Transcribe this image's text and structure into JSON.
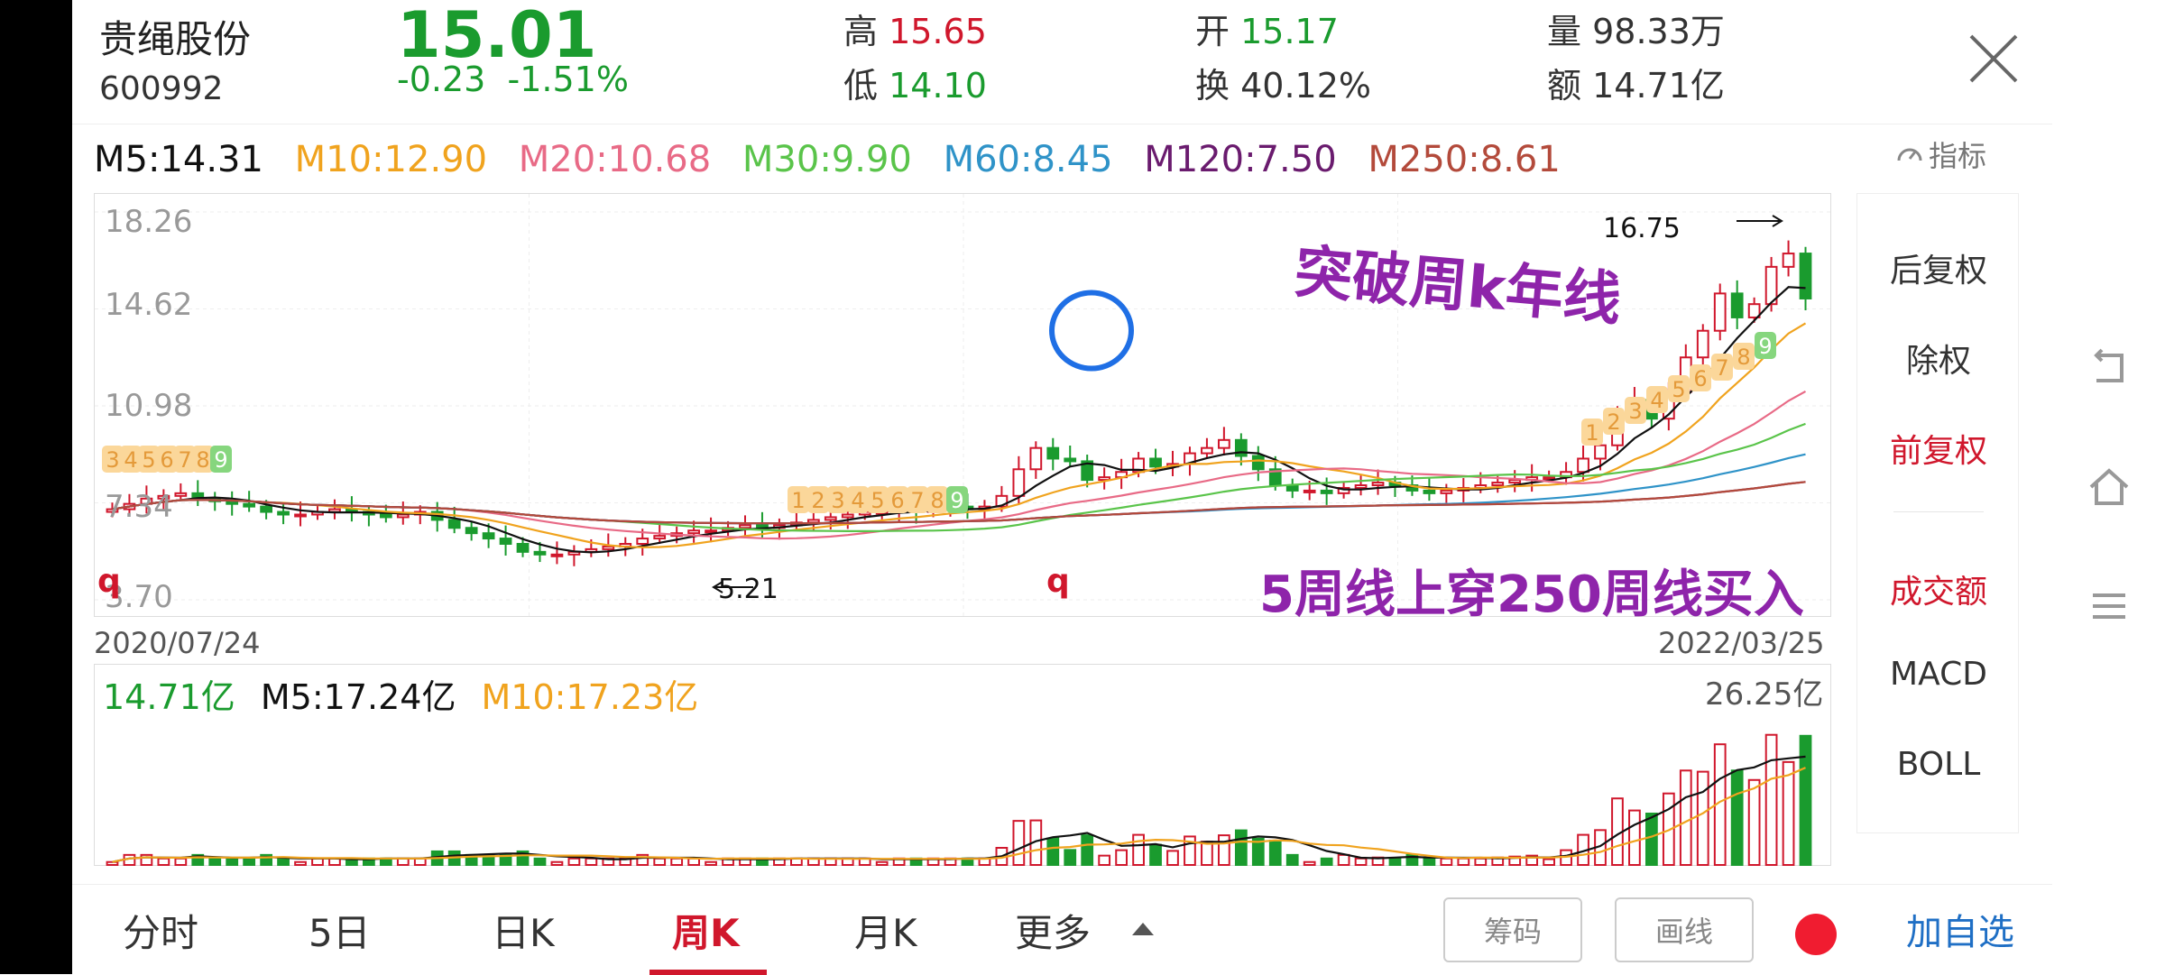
{
  "quote": {
    "name": "贵绳股份",
    "code": "600992",
    "price": "15.01",
    "change": "-0.23",
    "change_pct": "-1.51%",
    "high_label": "高",
    "high": "15.65",
    "low_label": "低",
    "low": "14.10",
    "open_label": "开",
    "open": "15.17",
    "turnover_label": "换",
    "turnover": "40.12%",
    "volume_label": "量",
    "volume": "98.33万",
    "amount_label": "额",
    "amount": "14.71亿"
  },
  "ma": {
    "m5": "M5:14.31",
    "m10": "M10:12.90",
    "m20": "M20:10.68",
    "m30": "M30:9.90",
    "m60": "M60:8.45",
    "m120": "M120:7.50",
    "m250": "M250:8.61"
  },
  "indicator_label": "指标",
  "axis": {
    "y_ticks": [
      "18.26",
      "14.62",
      "10.98",
      "7.34",
      "3.70"
    ],
    "start_date": "2020/07/24",
    "end_date": "2022/03/25"
  },
  "volume": {
    "value": "14.71亿",
    "m5": "M5:17.24亿",
    "m10": "M10:17.23亿",
    "max": "26.25亿"
  },
  "side_panel": {
    "items": [
      "后复权",
      "除权",
      "前复权",
      "成交额",
      "MACD",
      "BOLL"
    ],
    "active": "前复权"
  },
  "annotations": {
    "breakout": "突破周k年线",
    "buy_signal": "5周线上穿250周线买入",
    "high_mark": "16.75",
    "low_mark": "5.21",
    "q_left": "q",
    "q_mid": "q"
  },
  "td_counts": {
    "seq1": [
      "3",
      "4",
      "5",
      "6",
      "7",
      "8",
      "9"
    ],
    "seq2": [
      "1",
      "2",
      "3",
      "4",
      "5",
      "6",
      "7",
      "8",
      "9"
    ],
    "seq3": [
      "1",
      "2",
      "3",
      "4",
      "5",
      "6",
      "7",
      "8",
      "9"
    ]
  },
  "tabs": [
    "分时",
    "5日",
    "日K",
    "周K",
    "月K",
    "更多"
  ],
  "active_tab": "周K",
  "buttons": {
    "chips": "筹码",
    "draw": "画线",
    "add_fav": "加自选"
  },
  "colors": {
    "up": "#d0172c",
    "down": "#1a9b2e",
    "m5": "#111111",
    "m10": "#f0a31e",
    "m20": "#e86a86",
    "m30": "#5ac44a",
    "m60": "#2f93c8",
    "m120": "#6a1b6e",
    "m250": "#b34a3b",
    "annotation": "#8e24aa",
    "circle": "#1f6fe5"
  },
  "chart_data": {
    "type": "candlestick",
    "period": "weekly",
    "x_range": [
      "2020/07/24",
      "2022/03/25"
    ],
    "ylim": [
      3.7,
      18.26
    ],
    "close": [
      7.1,
      7.3,
      7.5,
      7.6,
      7.7,
      7.5,
      7.4,
      7.3,
      7.2,
      7.0,
      6.9,
      6.9,
      7.0,
      7.1,
      7.0,
      6.9,
      6.8,
      6.9,
      7.0,
      6.7,
      6.4,
      6.2,
      6.0,
      5.8,
      5.5,
      5.4,
      5.4,
      5.5,
      5.6,
      5.7,
      5.8,
      6.0,
      6.1,
      6.2,
      6.3,
      6.3,
      6.4,
      6.5,
      6.4,
      6.5,
      6.6,
      6.7,
      6.8,
      6.9,
      7.0,
      7.0,
      7.1,
      7.0,
      7.1,
      7.2,
      7.1,
      7.2,
      7.6,
      8.6,
      9.4,
      9.0,
      8.9,
      8.2,
      8.3,
      8.5,
      9.0,
      8.7,
      8.8,
      9.2,
      9.4,
      9.7,
      9.1,
      8.6,
      8.0,
      7.8,
      7.8,
      7.7,
      7.9,
      8.0,
      8.1,
      8.0,
      7.8,
      7.7,
      7.8,
      7.9,
      8.0,
      8.1,
      8.2,
      8.3,
      8.3,
      8.5,
      9.0,
      9.5,
      10.6,
      11.2,
      10.5,
      11.5,
      12.8,
      13.8,
      15.2,
      14.3,
      14.8,
      16.2,
      16.7,
      15.01
    ],
    "annotations": [
      "突破周k年线",
      "5周线上穿250周线买入",
      "16.75",
      "5.21"
    ]
  }
}
